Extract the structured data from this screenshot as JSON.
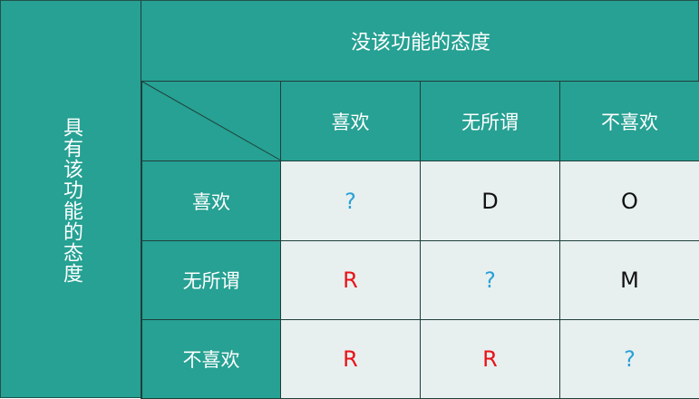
{
  "top_header": "没该功能的态度",
  "left_header": "具有该功能的态度",
  "columns": [
    "喜欢",
    "无所谓",
    "不喜欢"
  ],
  "rows": [
    {
      "label": "喜欢",
      "cells": [
        {
          "text": "?",
          "kind": "q"
        },
        {
          "text": "D",
          "kind": "n"
        },
        {
          "text": "O",
          "kind": "n"
        }
      ]
    },
    {
      "label": "无所谓",
      "cells": [
        {
          "text": "R",
          "kind": "r"
        },
        {
          "text": "?",
          "kind": "q"
        },
        {
          "text": "M",
          "kind": "n"
        }
      ]
    },
    {
      "label": "不喜欢",
      "cells": [
        {
          "text": "R",
          "kind": "r"
        },
        {
          "text": "R",
          "kind": "r"
        },
        {
          "text": "?",
          "kind": "q"
        }
      ]
    }
  ],
  "colors": {
    "header_bg": "#26a193",
    "cell_bg": "#e7f0ef",
    "question_mark": "#2aa0d8",
    "reverse": "#e8141a",
    "text_dark": "#111111"
  }
}
